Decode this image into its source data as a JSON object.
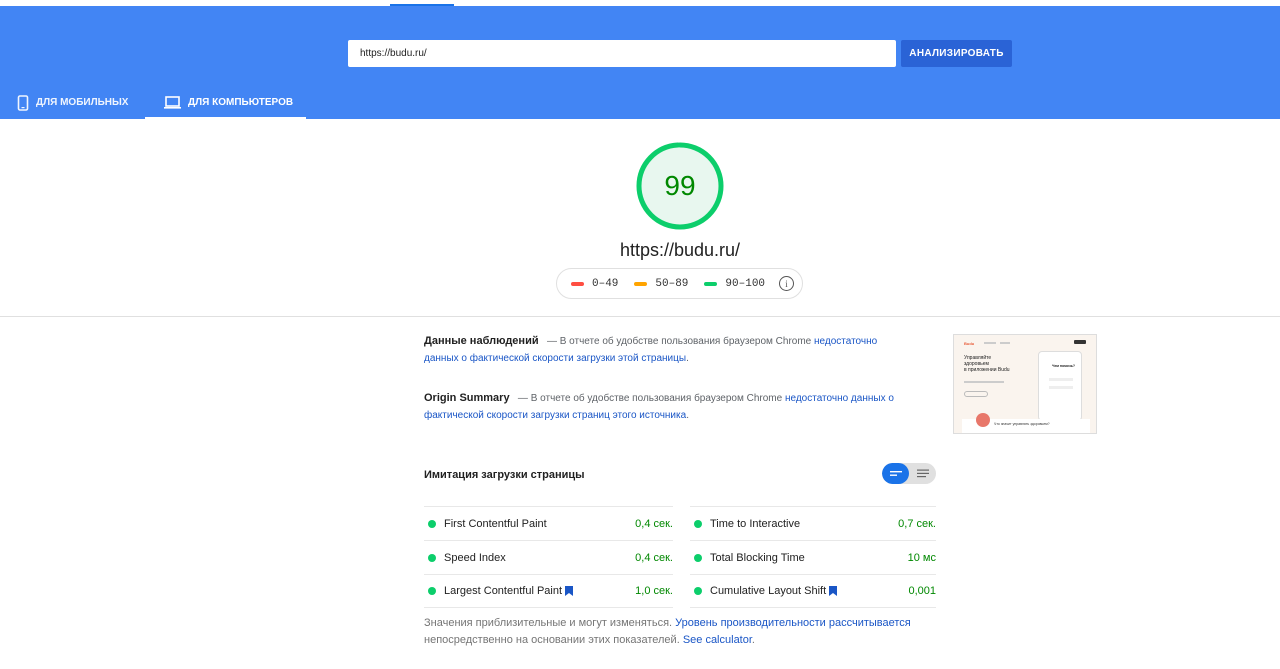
{
  "search": {
    "url_value": "https://budu.ru/",
    "analyze_label": "АНАЛИЗИРОВАТЬ"
  },
  "tabs": [
    {
      "label": "ДЛЯ МОБИЛЬНЫХ",
      "icon": "smartphone-icon",
      "active": false
    },
    {
      "label": "ДЛЯ КОМПЬЮТЕРОВ",
      "icon": "laptop-icon",
      "active": true
    }
  ],
  "score": {
    "value": "99",
    "fraction": 0.99,
    "url": "https://budu.ru/",
    "color": "#0cce6b"
  },
  "legend": [
    {
      "label": "0–49",
      "color": "#ff4e42"
    },
    {
      "label": "50–89",
      "color": "#ffa400"
    },
    {
      "label": "90–100",
      "color": "#0cce6b"
    }
  ],
  "field_data": {
    "title": "Данные наблюдений",
    "text": "— В отчете об удобстве пользования браузером Chrome",
    "link": "недостаточно данных о фактической скорости загрузки этой страницы",
    "end": "."
  },
  "origin_summary": {
    "title": "Origin Summary",
    "text": "— В отчете об удобстве пользования браузером Chrome",
    "link": "недостаточно данных о фактической скорости загрузки страниц этого источника",
    "end": "."
  },
  "thumbnail": {
    "logo": "Budu",
    "headline_1": "Управляйте",
    "headline_2": "здоровьем",
    "headline_3": "в приложении Budu",
    "phone_title": "Чем помочь?",
    "bottom_text": "Что значит управлять здоровьем?"
  },
  "lab": {
    "title": "Имитация загрузки страницы"
  },
  "metrics_left": [
    {
      "name": "First Contentful Paint",
      "value": "0,4 сек.",
      "flag": false
    },
    {
      "name": "Speed Index",
      "value": "0,4 сек.",
      "flag": false
    },
    {
      "name": "Largest Contentful Paint",
      "value": "1,0 сек.",
      "flag": true
    }
  ],
  "metrics_right": [
    {
      "name": "Time to Interactive",
      "value": "0,7 сек.",
      "flag": false
    },
    {
      "name": "Total Blocking Time",
      "value": "10 мс",
      "flag": false
    },
    {
      "name": "Cumulative Layout Shift",
      "value": "0,001",
      "flag": true
    }
  ],
  "footnote": {
    "text_1": "Значения приблизительные и могут изменяться.",
    "link_1": "Уровень производительности рассчитывается",
    "text_2": "непосредственно на основании этих показателей.",
    "link_2": "See calculator",
    "end": "."
  }
}
